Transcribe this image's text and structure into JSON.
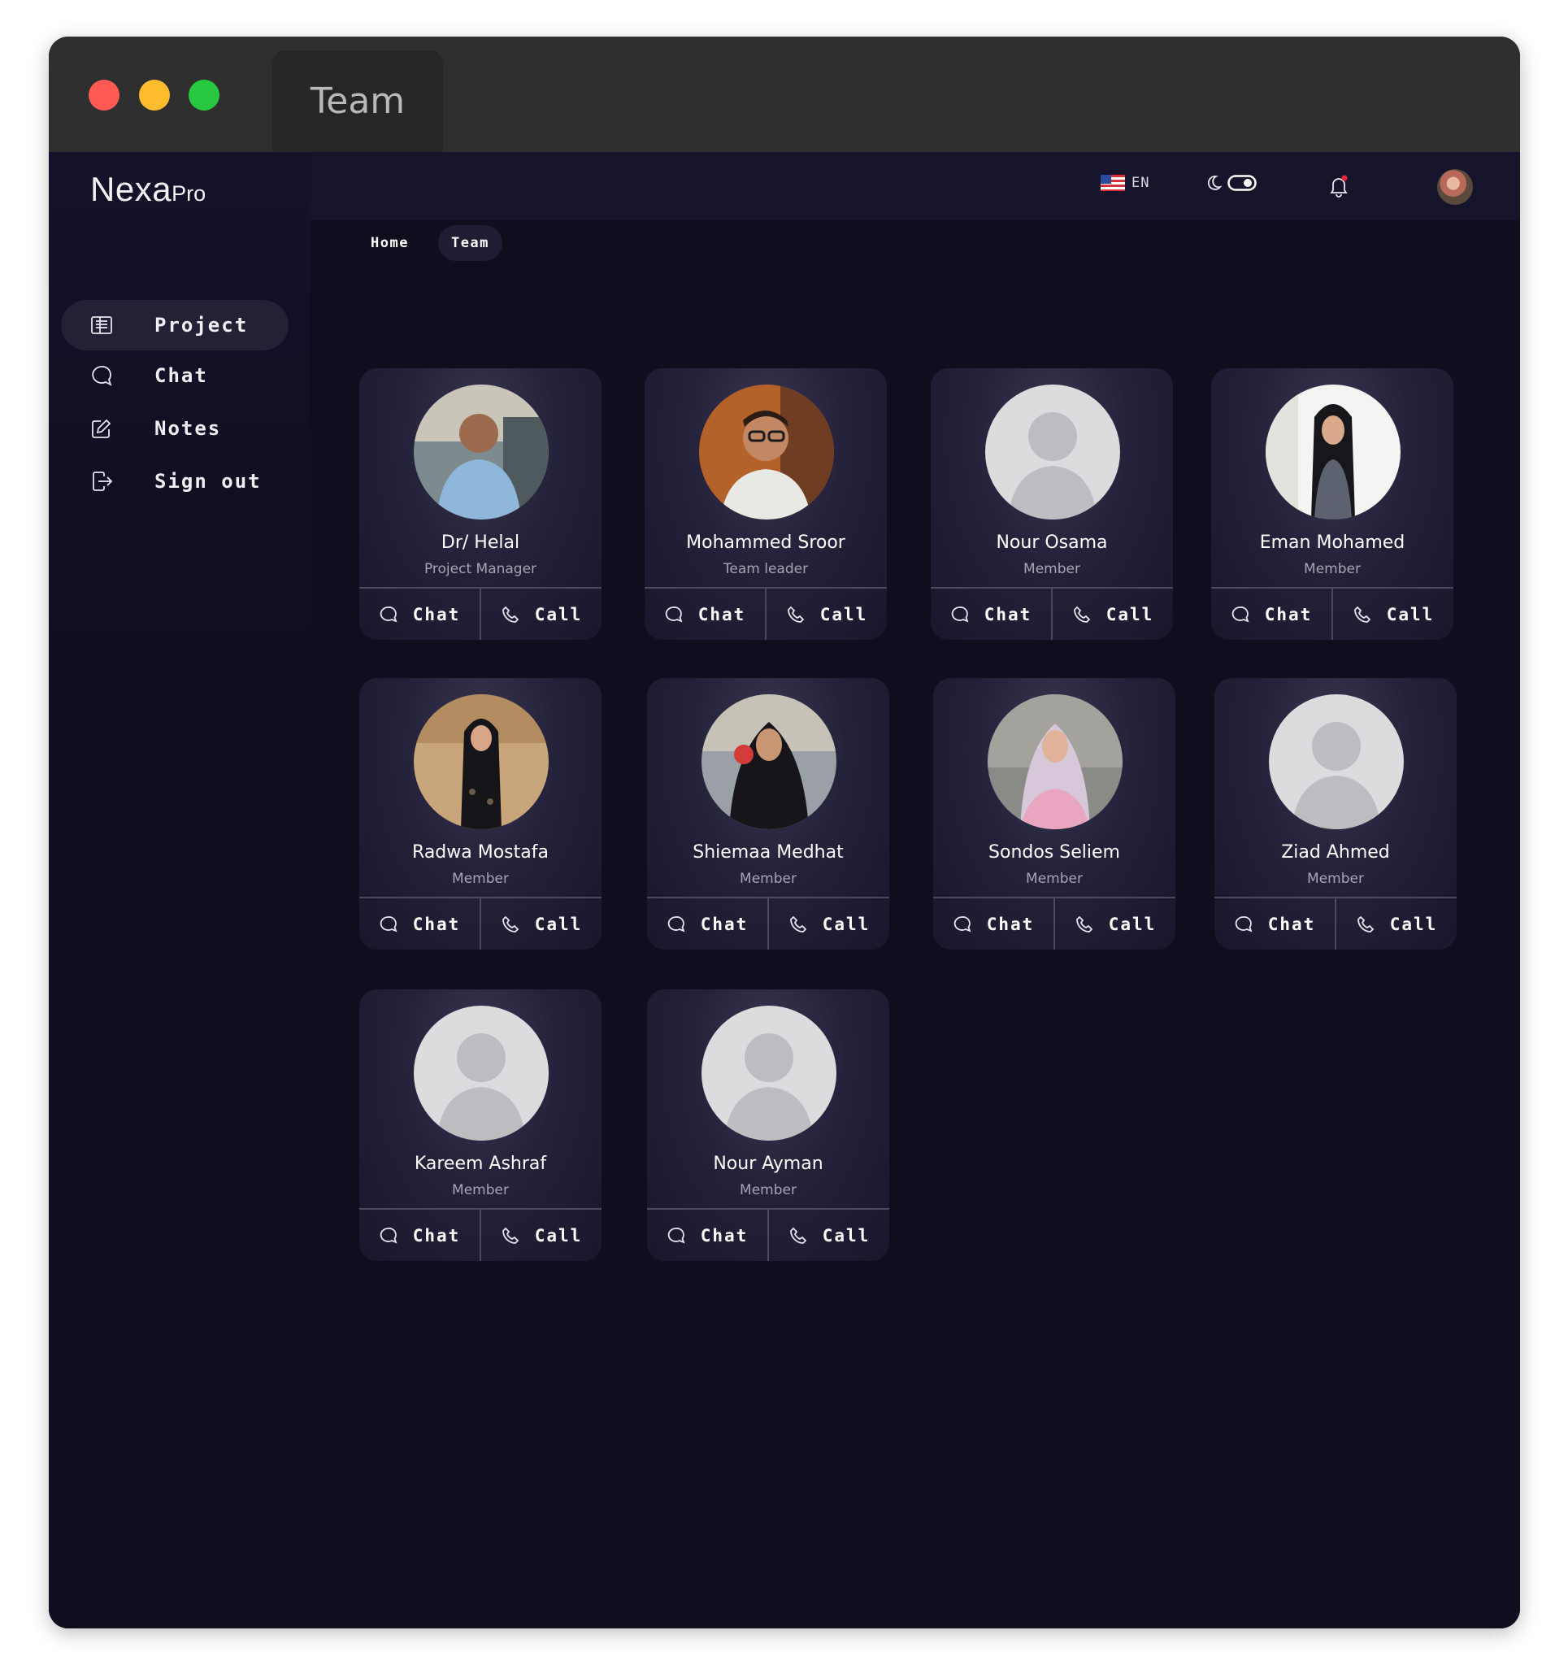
{
  "window": {
    "tab_title": "Team"
  },
  "brand": {
    "name_main": "Nexa",
    "name_suffix": "Pro"
  },
  "sidebar": {
    "items": [
      {
        "label": "Project",
        "icon": "newspaper-icon",
        "active": true
      },
      {
        "label": "Chat",
        "icon": "chat-bubble-icon",
        "active": false
      },
      {
        "label": "Notes",
        "icon": "edit-note-icon",
        "active": false
      },
      {
        "label": "Sign out",
        "icon": "sign-out-icon",
        "active": false
      }
    ]
  },
  "topbar": {
    "language": "EN",
    "language_icon": "us-flag-icon",
    "theme_icon": "moon-toggle-icon",
    "notification_icon": "bell-icon",
    "has_notification": true,
    "avatar_icon": "user-avatar"
  },
  "breadcrumb": {
    "items": [
      "Home",
      "Team"
    ],
    "active": "Team"
  },
  "actions": {
    "chat_label": "Chat",
    "call_label": "Call"
  },
  "members": [
    {
      "name": "Dr/ Helal",
      "role": "Project Manager",
      "photo": "photo"
    },
    {
      "name": "Mohammed Sroor",
      "role": "Team leader",
      "photo": "photo"
    },
    {
      "name": "Nour Osama",
      "role": "Member",
      "photo": "placeholder"
    },
    {
      "name": "Eman Mohamed",
      "role": "Member",
      "photo": "photo"
    },
    {
      "name": "Radwa Mostafa",
      "role": "Member",
      "photo": "photo"
    },
    {
      "name": "Shiemaa Medhat",
      "role": "Member",
      "photo": "photo"
    },
    {
      "name": "Sondos Seliem",
      "role": "Member",
      "photo": "photo"
    },
    {
      "name": "Ziad Ahmed",
      "role": "Member",
      "photo": "placeholder"
    },
    {
      "name": "Kareem Ashraf",
      "role": "Member",
      "photo": "placeholder"
    },
    {
      "name": "Nour Ayman",
      "role": "Member",
      "photo": "placeholder"
    }
  ],
  "colors": {
    "background": "#0f0d1e",
    "topbar": "#15142a",
    "titlebar": "#2f2f2f",
    "active_nav": "#232136",
    "notification_dot": "#e5263a"
  }
}
